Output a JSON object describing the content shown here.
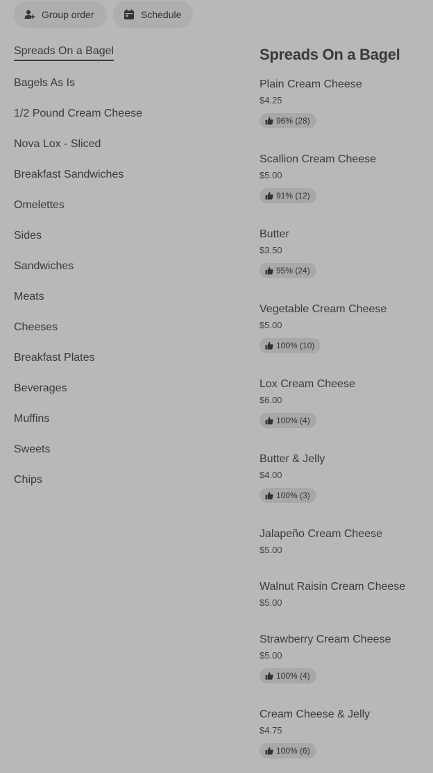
{
  "top_buttons": {
    "group_order": {
      "label": "Group order",
      "icon": "add-person-icon"
    },
    "schedule": {
      "label": "Schedule",
      "icon": "calendar-icon"
    }
  },
  "sidebar": {
    "items": [
      {
        "label": "Spreads On a Bagel",
        "active": true
      },
      {
        "label": "Bagels As Is"
      },
      {
        "label": "1/2 Pound Cream Cheese"
      },
      {
        "label": "Nova Lox - Sliced"
      },
      {
        "label": "Breakfast Sandwiches"
      },
      {
        "label": "Omelettes"
      },
      {
        "label": "Sides"
      },
      {
        "label": "Sandwiches"
      },
      {
        "label": "Meats"
      },
      {
        "label": "Cheeses"
      },
      {
        "label": "Breakfast Plates"
      },
      {
        "label": "Beverages"
      },
      {
        "label": "Muffins"
      },
      {
        "label": "Sweets"
      },
      {
        "label": "Chips"
      }
    ]
  },
  "main": {
    "section_title": "Spreads On a Bagel",
    "items": [
      {
        "name": "Plain Cream Cheese",
        "price": "$4.25",
        "rating": "96% (28)"
      },
      {
        "name": "Scallion Cream Cheese",
        "price": "$5.00",
        "rating": "91% (12)"
      },
      {
        "name": "Butter",
        "price": "$3.50",
        "rating": "95% (24)"
      },
      {
        "name": "Vegetable Cream Cheese",
        "price": "$5.00",
        "rating": "100% (10)"
      },
      {
        "name": "Lox Cream Cheese",
        "price": "$6.00",
        "rating": "100% (4)"
      },
      {
        "name": "Butter & Jelly",
        "price": "$4.00",
        "rating": "100% (3)"
      },
      {
        "name": "Jalapeño Cream Cheese",
        "price": "$5.00"
      },
      {
        "name": "Walnut Raisin Cream Cheese",
        "price": "$5.00"
      },
      {
        "name": "Strawberry Cream Cheese",
        "price": "$5.00",
        "rating": "100% (4)"
      },
      {
        "name": "Cream Cheese & Jelly",
        "price": "$4.75",
        "rating": "100% (6)"
      }
    ]
  },
  "colors": {
    "background": "#b8b8b8",
    "pill": "#aeaeae",
    "text": "#3a3a3a"
  }
}
